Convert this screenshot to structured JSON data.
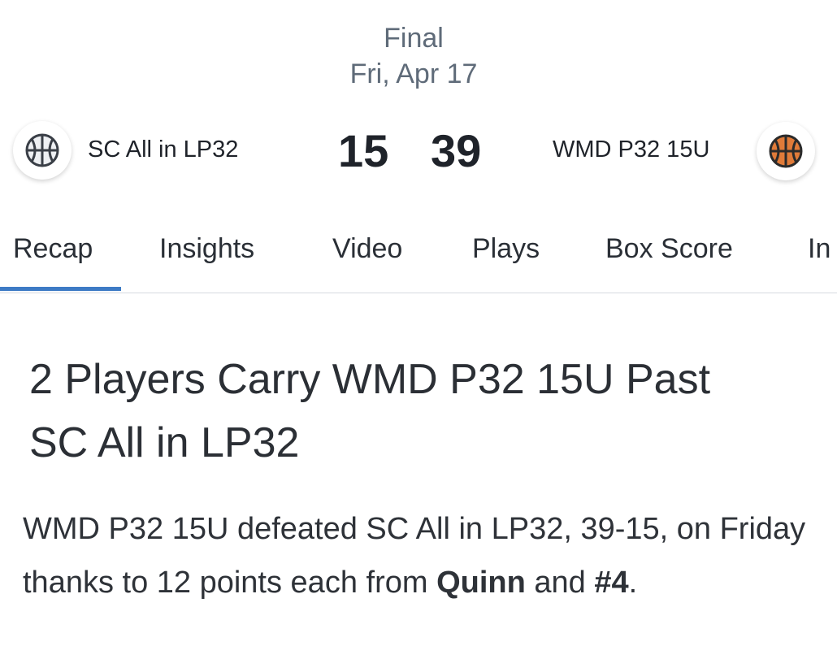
{
  "game": {
    "status": "Final",
    "date": "Fri, Apr 17"
  },
  "home_team": {
    "name": "SC All in LP32",
    "score": "15",
    "icon": "basketball-icon",
    "icon_color": "#3a3f47"
  },
  "away_team": {
    "name": "WMD P32 15U",
    "score": "39",
    "icon": "basketball-icon",
    "icon_color": "#e07b39"
  },
  "tabs": [
    {
      "label": "Recap",
      "active": true
    },
    {
      "label": "Insights"
    },
    {
      "label": "Video"
    },
    {
      "label": "Plays"
    },
    {
      "label": "Box Score"
    },
    {
      "label": "In"
    }
  ],
  "colors": {
    "accent": "#3d7bc5",
    "muted_text": "#5f6b79"
  },
  "article": {
    "headline": "2 Players Carry WMD P32 15U Past SC All in LP32",
    "summary_part1": "WMD P32 15U defeated SC All in LP32, 39-15, on Friday thanks to 12 points each from ",
    "summary_bold1": "Quinn",
    "summary_part2": " and ",
    "summary_bold2": "#4",
    "summary_part3": "."
  }
}
